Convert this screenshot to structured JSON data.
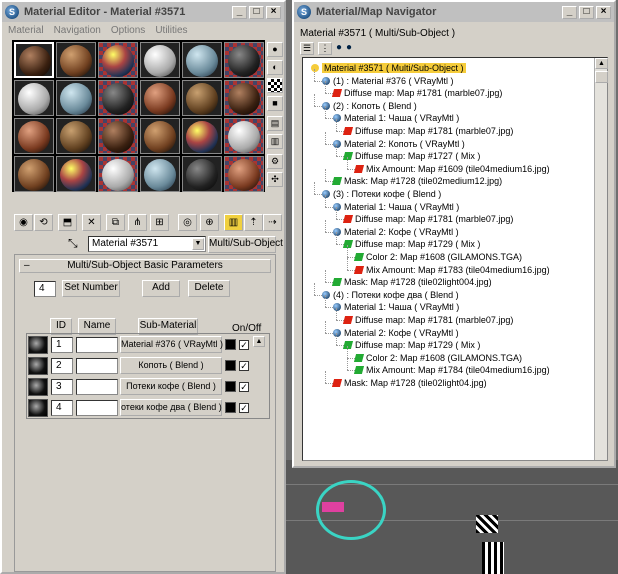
{
  "material_editor": {
    "title": "Material Editor - Material #3571",
    "menu": [
      "Material",
      "Navigation",
      "Options",
      "Utilities"
    ],
    "material_name": "Material #3571",
    "material_type": "Multi/Sub-Object",
    "rollout_title": "Multi/Sub-Object Basic Parameters",
    "set_number_value": "4",
    "set_number_label": "Set Number",
    "add_label": "Add",
    "delete_label": "Delete",
    "col_id": "ID",
    "col_name": "Name",
    "col_submaterial": "Sub-Material",
    "col_onoff": "On/Off",
    "rows": [
      {
        "id": "1",
        "sub": "Material #376  ( VRayMtl )"
      },
      {
        "id": "2",
        "sub": "Копоть  ( Blend )"
      },
      {
        "id": "3",
        "sub": "Потеки кофе  ( Blend )"
      },
      {
        "id": "4",
        "sub": "отеки кофе два  ( Blend )"
      }
    ]
  },
  "navigator": {
    "title": "Material/Map Navigator",
    "header": "Material #3571  ( Multi/Sub-Object )",
    "tree": [
      {
        "lvl": 0,
        "icon": "sphere",
        "text": "Material #3571  ( Multi/Sub-Object )",
        "hl": true
      },
      {
        "lvl": 1,
        "icon": "sphere",
        "text": "(1) : Material #376  ( VRayMtl )"
      },
      {
        "lvl": 2,
        "icon": "red",
        "text": "Diffuse map: Map #1781 (marble07.jpg)"
      },
      {
        "lvl": 1,
        "icon": "sphere",
        "text": "(2) : Копоть  ( Blend )"
      },
      {
        "lvl": 2,
        "icon": "sphere",
        "text": "Material 1: Чаша  ( VRayMtl )"
      },
      {
        "lvl": 3,
        "icon": "red",
        "text": "Diffuse map: Map #1781 (marble07.jpg)"
      },
      {
        "lvl": 2,
        "icon": "sphere",
        "text": "Material 2: Копоть  ( VRayMtl )"
      },
      {
        "lvl": 3,
        "icon": "green",
        "text": "Diffuse map: Map #1727  ( Mix )"
      },
      {
        "lvl": 4,
        "icon": "red",
        "text": "Mix Amount: Map #1609 (tile04medium16.jpg)"
      },
      {
        "lvl": 2,
        "icon": "green",
        "text": "Mask: Map #1728 (tile02medium12.jpg)"
      },
      {
        "lvl": 1,
        "icon": "sphere",
        "text": "(3) : Потеки кофе  ( Blend )"
      },
      {
        "lvl": 2,
        "icon": "sphere",
        "text": "Material 1: Чаша  ( VRayMtl )"
      },
      {
        "lvl": 3,
        "icon": "red",
        "text": "Diffuse map: Map #1781 (marble07.jpg)"
      },
      {
        "lvl": 2,
        "icon": "sphere",
        "text": "Material 2: Кофе  ( VRayMtl )"
      },
      {
        "lvl": 3,
        "icon": "green",
        "text": "Diffuse map: Map #1729  ( Mix )"
      },
      {
        "lvl": 4,
        "icon": "green",
        "text": "Color 2: Map #1608 (GILAMONS.TGA)"
      },
      {
        "lvl": 4,
        "icon": "red",
        "text": "Mix Amount: Map #1783 (tile04medium16.jpg)"
      },
      {
        "lvl": 2,
        "icon": "green",
        "text": "Mask: Map #1728 (tile02light004.jpg)"
      },
      {
        "lvl": 1,
        "icon": "sphere",
        "text": "(4) : Потеки кофе два  ( Blend )"
      },
      {
        "lvl": 2,
        "icon": "sphere",
        "text": "Material 1: Чаша  ( VRayMtl )"
      },
      {
        "lvl": 3,
        "icon": "red",
        "text": "Diffuse map: Map #1781 (marble07.jpg)"
      },
      {
        "lvl": 2,
        "icon": "sphere",
        "text": "Material 2: Кофе  ( VRayMtl )"
      },
      {
        "lvl": 3,
        "icon": "green",
        "text": "Diffuse map: Map #1729  ( Mix )"
      },
      {
        "lvl": 4,
        "icon": "green",
        "text": "Color 2: Map #1608 (GILAMONS.TGA)"
      },
      {
        "lvl": 4,
        "icon": "green",
        "text": "Mix Amount: Map #1784 (tile04medium16.jpg)"
      },
      {
        "lvl": 2,
        "icon": "red",
        "text": "Mask: Map #1728 (tile02light04.jpg)"
      }
    ]
  },
  "colors": {
    "highlight": "#f5cc3a",
    "title_bg": "#c0c0c0",
    "window_bg": "#d4d0c8"
  }
}
